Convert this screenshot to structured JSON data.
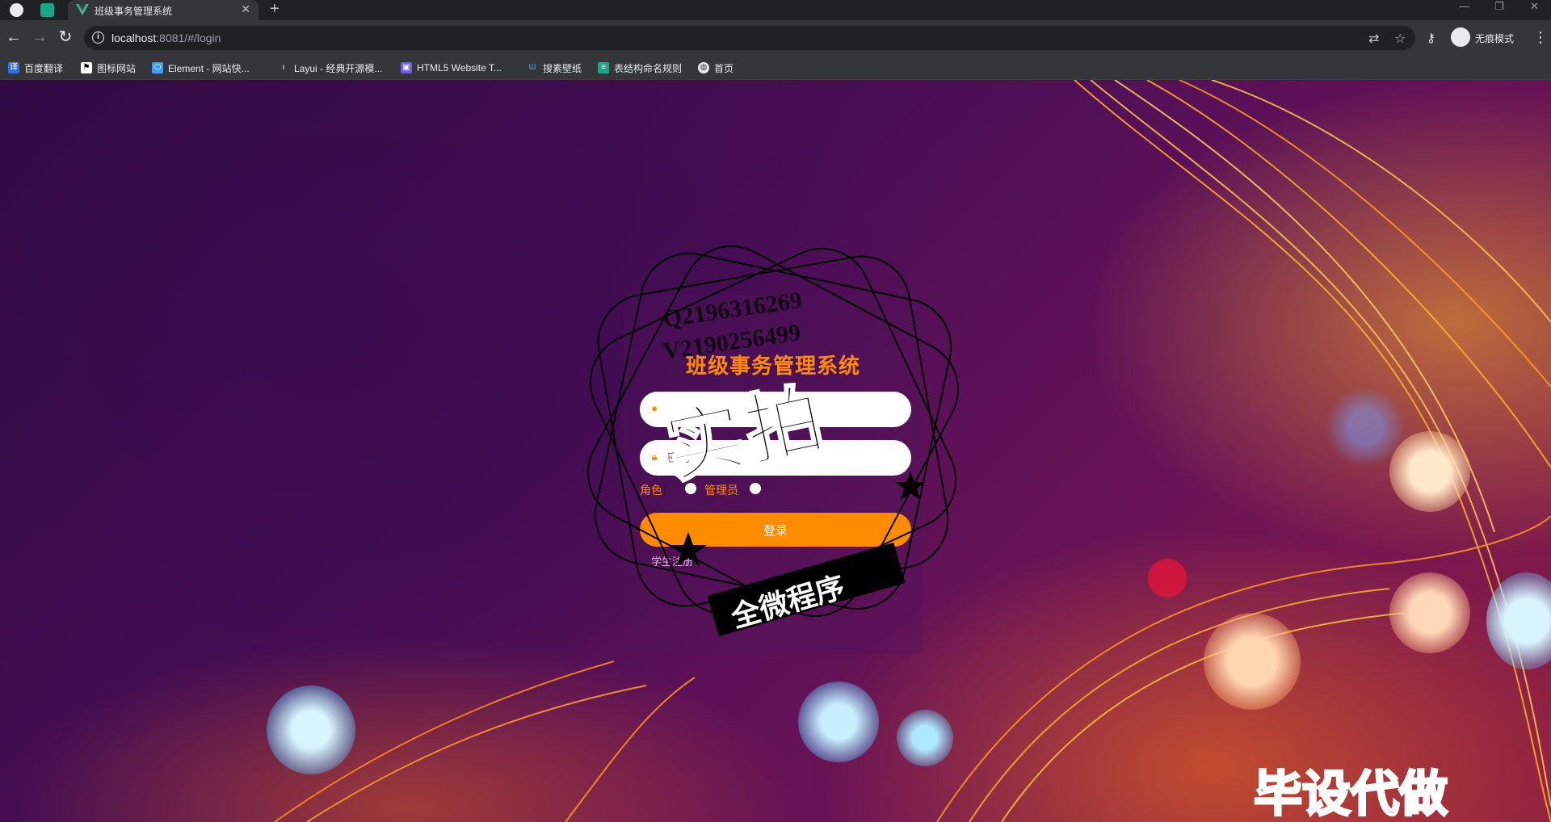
{
  "browser": {
    "tab_title": "班级事务管理系统",
    "url_host": "localhost",
    "url_rest": ":8081/#/login",
    "profile_label": "无痕模式",
    "bookmarks": [
      "百度翻译",
      "图标网站",
      "Element - 网站快...",
      "Layui - 经典开源模...",
      "HTML5 Website T...",
      "搜素壁纸",
      "表结构命名规则",
      "首页"
    ]
  },
  "login": {
    "title": "班级事务管理系统",
    "username_placeholder": "",
    "password_placeholder": "密码",
    "role_label": "角色",
    "role_options": [
      "管理员"
    ],
    "login_button": "登录",
    "register_link": "学生注册"
  },
  "watermark": {
    "qq": "Q2196316269",
    "vx": "V2190256499",
    "big": "实拍",
    "banner": "全微程序",
    "corner": "毕设代做"
  },
  "colors": {
    "accent": "#ff8c00",
    "chrome_dark": "#202124",
    "chrome_mid": "#35363a"
  }
}
